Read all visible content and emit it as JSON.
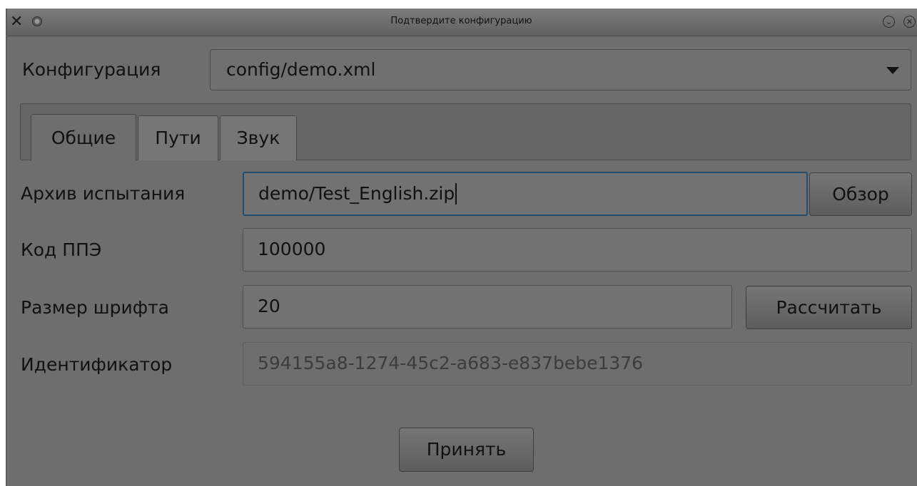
{
  "window": {
    "title": "Подтвердите конфигурацию",
    "app_icon": "x-logo-icon",
    "minimize_icon": "chevron-down-icon",
    "close_icon": "close-icon"
  },
  "config": {
    "label": "Конфигурация",
    "selected": "config/demo.xml"
  },
  "tabs": [
    {
      "label": "Общие",
      "active": true
    },
    {
      "label": "Пути",
      "active": false
    },
    {
      "label": "Звук",
      "active": false
    }
  ],
  "form": {
    "archive": {
      "label": "Архив испытания",
      "value": "demo/Test_English.zip",
      "browse_label": "Обзор"
    },
    "ppe_code": {
      "label": "Код ППЭ",
      "value": "100000"
    },
    "font_size": {
      "label": "Размер шрифта",
      "value": "20",
      "calc_label": "Рассчитать"
    },
    "identifier": {
      "label": "Идентификатор",
      "value": "594155a8-1274-45c2-a683-e837bebe1376"
    }
  },
  "footer": {
    "accept_label": "Принять"
  }
}
